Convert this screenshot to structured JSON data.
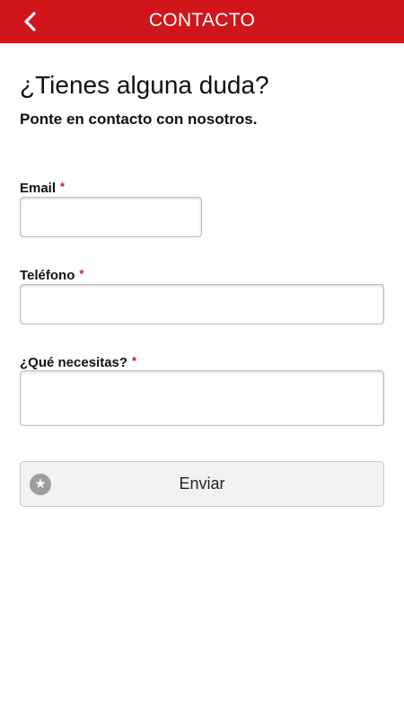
{
  "header": {
    "title": "CONTACTO",
    "back_icon": "chevron-left-icon",
    "background_color": "#d0161b"
  },
  "intro": {
    "heading": "¿Tienes alguna duda?",
    "subheading": "Ponte en contacto con nosotros."
  },
  "form": {
    "required_marker": "*",
    "email": {
      "label": "Email",
      "value": ""
    },
    "phone": {
      "label": "Teléfono",
      "value": ""
    },
    "message": {
      "label": "¿Qué necesitas?",
      "value": ""
    },
    "submit": {
      "label": "Enviar",
      "icon": "star-icon"
    }
  }
}
